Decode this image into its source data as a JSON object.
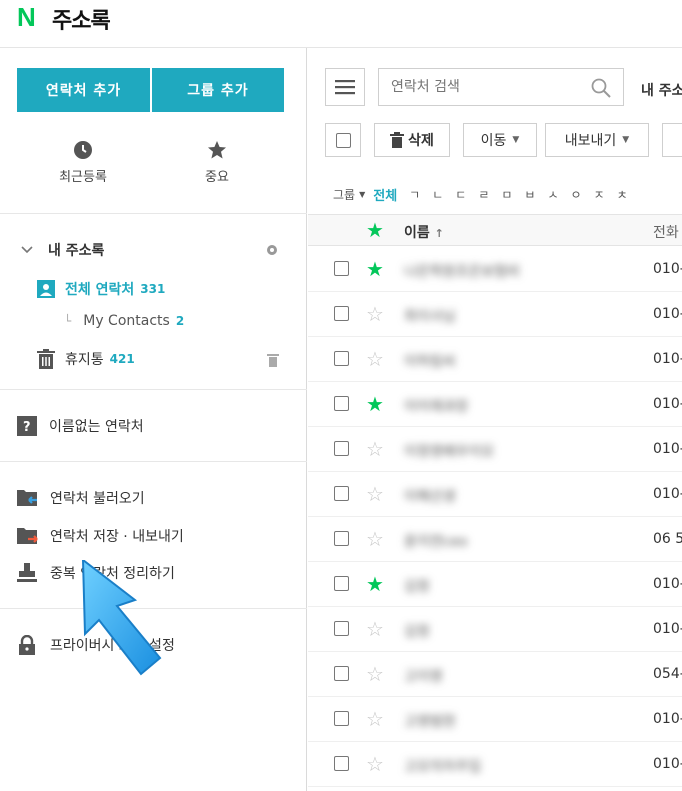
{
  "header": {
    "logo": "N",
    "title": "주소록"
  },
  "sidebar": {
    "add_contact": "연락처 추가",
    "add_group": "그룹 추가",
    "quick": [
      {
        "icon": "clock-icon",
        "label": "최근등록"
      },
      {
        "icon": "star-icon",
        "label": "중요"
      }
    ],
    "my_addressbook": "내 주소록",
    "all_contacts": {
      "label": "전체 연락처",
      "count": "331"
    },
    "my_contacts": {
      "label": "My Contacts",
      "count": "2"
    },
    "trash": {
      "label": "휴지통",
      "count": "421"
    },
    "unnamed": "이름없는 연락처",
    "import": "연락처 불러오기",
    "export": "연락처 저장 · 내보내기",
    "dedupe": "중복 연락처 정리하기",
    "privacy": "프라이버시 보호 설정"
  },
  "main": {
    "search_placeholder": "연락처 검색",
    "my_label": "내 주소",
    "toolbar": {
      "delete": "삭제",
      "move": "이동",
      "export": "내보내기"
    },
    "alpha": {
      "group": "그룹",
      "all": "전체",
      "letters": [
        "ㄱ",
        "ㄴ",
        "ㄷ",
        "ㄹ",
        "ㅁ",
        "ㅂ",
        "ㅅ",
        "ㅇ",
        "ㅈ",
        "ㅊ"
      ]
    },
    "columns": {
      "name": "이름",
      "phone": "전화"
    },
    "rows": [
      {
        "starred": true,
        "name": "나은학원조은보험비",
        "phone": "010-"
      },
      {
        "starred": false,
        "name": "최이사님",
        "phone": "010-"
      },
      {
        "starred": false,
        "name": "이하림씨",
        "phone": "010-"
      },
      {
        "starred": true,
        "name": "이어재과장",
        "phone": "010-"
      },
      {
        "starred": false,
        "name": "이정영배우이모",
        "phone": "010-"
      },
      {
        "starred": false,
        "name": "이해선생",
        "phone": "010-"
      },
      {
        "starred": false,
        "name": "윤지연ceo",
        "phone": "06 5"
      },
      {
        "starred": true,
        "name": "김정",
        "phone": "010-"
      },
      {
        "starred": false,
        "name": "김정",
        "phone": "010-"
      },
      {
        "starred": false,
        "name": "고이영",
        "phone": "054-"
      },
      {
        "starred": false,
        "name": "고영범현",
        "phone": "010-"
      },
      {
        "starred": false,
        "name": "고모의자주입",
        "phone": "010-"
      }
    ]
  },
  "colors": {
    "accent": "#1fa9bf",
    "star_on": "#03c75a",
    "brand": "#03c75a"
  }
}
